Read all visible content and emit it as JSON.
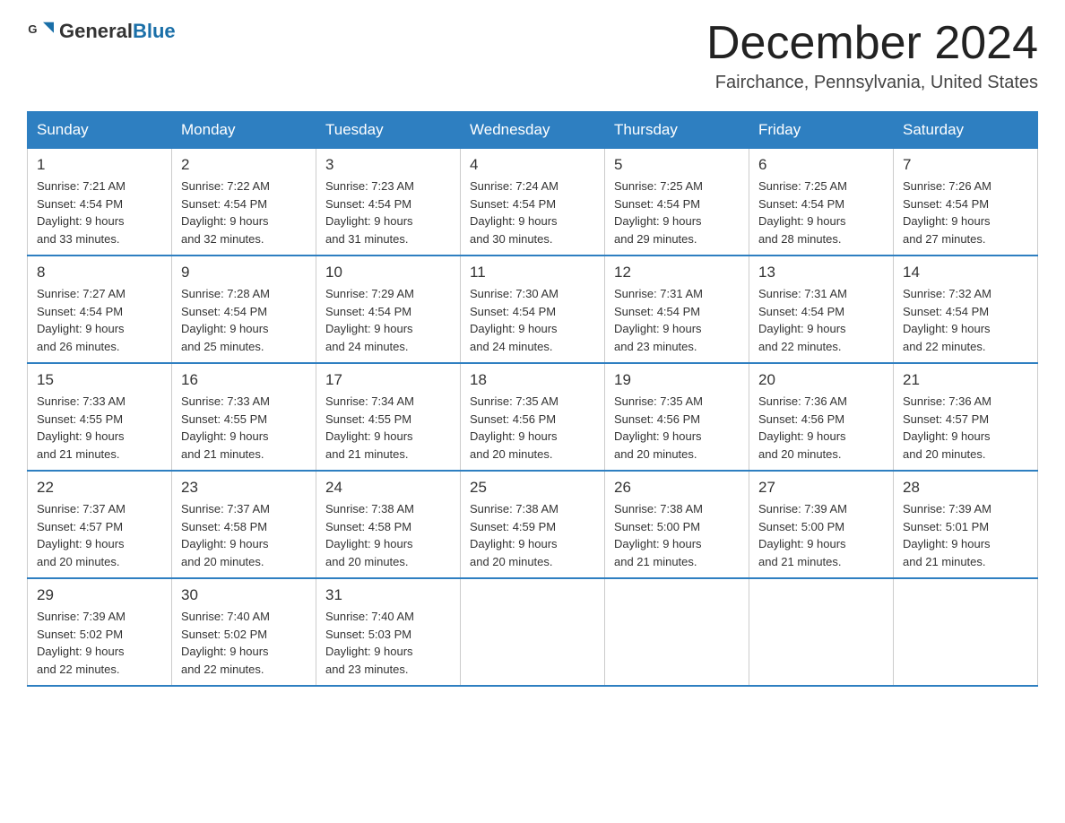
{
  "header": {
    "logo_general": "General",
    "logo_blue": "Blue",
    "title": "December 2024",
    "subtitle": "Fairchance, Pennsylvania, United States"
  },
  "weekdays": [
    "Sunday",
    "Monday",
    "Tuesday",
    "Wednesday",
    "Thursday",
    "Friday",
    "Saturday"
  ],
  "weeks": [
    [
      {
        "day": "1",
        "sunrise": "7:21 AM",
        "sunset": "4:54 PM",
        "daylight": "9 hours and 33 minutes."
      },
      {
        "day": "2",
        "sunrise": "7:22 AM",
        "sunset": "4:54 PM",
        "daylight": "9 hours and 32 minutes."
      },
      {
        "day": "3",
        "sunrise": "7:23 AM",
        "sunset": "4:54 PM",
        "daylight": "9 hours and 31 minutes."
      },
      {
        "day": "4",
        "sunrise": "7:24 AM",
        "sunset": "4:54 PM",
        "daylight": "9 hours and 30 minutes."
      },
      {
        "day": "5",
        "sunrise": "7:25 AM",
        "sunset": "4:54 PM",
        "daylight": "9 hours and 29 minutes."
      },
      {
        "day": "6",
        "sunrise": "7:25 AM",
        "sunset": "4:54 PM",
        "daylight": "9 hours and 28 minutes."
      },
      {
        "day": "7",
        "sunrise": "7:26 AM",
        "sunset": "4:54 PM",
        "daylight": "9 hours and 27 minutes."
      }
    ],
    [
      {
        "day": "8",
        "sunrise": "7:27 AM",
        "sunset": "4:54 PM",
        "daylight": "9 hours and 26 minutes."
      },
      {
        "day": "9",
        "sunrise": "7:28 AM",
        "sunset": "4:54 PM",
        "daylight": "9 hours and 25 minutes."
      },
      {
        "day": "10",
        "sunrise": "7:29 AM",
        "sunset": "4:54 PM",
        "daylight": "9 hours and 24 minutes."
      },
      {
        "day": "11",
        "sunrise": "7:30 AM",
        "sunset": "4:54 PM",
        "daylight": "9 hours and 24 minutes."
      },
      {
        "day": "12",
        "sunrise": "7:31 AM",
        "sunset": "4:54 PM",
        "daylight": "9 hours and 23 minutes."
      },
      {
        "day": "13",
        "sunrise": "7:31 AM",
        "sunset": "4:54 PM",
        "daylight": "9 hours and 22 minutes."
      },
      {
        "day": "14",
        "sunrise": "7:32 AM",
        "sunset": "4:54 PM",
        "daylight": "9 hours and 22 minutes."
      }
    ],
    [
      {
        "day": "15",
        "sunrise": "7:33 AM",
        "sunset": "4:55 PM",
        "daylight": "9 hours and 21 minutes."
      },
      {
        "day": "16",
        "sunrise": "7:33 AM",
        "sunset": "4:55 PM",
        "daylight": "9 hours and 21 minutes."
      },
      {
        "day": "17",
        "sunrise": "7:34 AM",
        "sunset": "4:55 PM",
        "daylight": "9 hours and 21 minutes."
      },
      {
        "day": "18",
        "sunrise": "7:35 AM",
        "sunset": "4:56 PM",
        "daylight": "9 hours and 20 minutes."
      },
      {
        "day": "19",
        "sunrise": "7:35 AM",
        "sunset": "4:56 PM",
        "daylight": "9 hours and 20 minutes."
      },
      {
        "day": "20",
        "sunrise": "7:36 AM",
        "sunset": "4:56 PM",
        "daylight": "9 hours and 20 minutes."
      },
      {
        "day": "21",
        "sunrise": "7:36 AM",
        "sunset": "4:57 PM",
        "daylight": "9 hours and 20 minutes."
      }
    ],
    [
      {
        "day": "22",
        "sunrise": "7:37 AM",
        "sunset": "4:57 PM",
        "daylight": "9 hours and 20 minutes."
      },
      {
        "day": "23",
        "sunrise": "7:37 AM",
        "sunset": "4:58 PM",
        "daylight": "9 hours and 20 minutes."
      },
      {
        "day": "24",
        "sunrise": "7:38 AM",
        "sunset": "4:58 PM",
        "daylight": "9 hours and 20 minutes."
      },
      {
        "day": "25",
        "sunrise": "7:38 AM",
        "sunset": "4:59 PM",
        "daylight": "9 hours and 20 minutes."
      },
      {
        "day": "26",
        "sunrise": "7:38 AM",
        "sunset": "5:00 PM",
        "daylight": "9 hours and 21 minutes."
      },
      {
        "day": "27",
        "sunrise": "7:39 AM",
        "sunset": "5:00 PM",
        "daylight": "9 hours and 21 minutes."
      },
      {
        "day": "28",
        "sunrise": "7:39 AM",
        "sunset": "5:01 PM",
        "daylight": "9 hours and 21 minutes."
      }
    ],
    [
      {
        "day": "29",
        "sunrise": "7:39 AM",
        "sunset": "5:02 PM",
        "daylight": "9 hours and 22 minutes."
      },
      {
        "day": "30",
        "sunrise": "7:40 AM",
        "sunset": "5:02 PM",
        "daylight": "9 hours and 22 minutes."
      },
      {
        "day": "31",
        "sunrise": "7:40 AM",
        "sunset": "5:03 PM",
        "daylight": "9 hours and 23 minutes."
      },
      null,
      null,
      null,
      null
    ]
  ],
  "labels": {
    "sunrise": "Sunrise:",
    "sunset": "Sunset:",
    "daylight": "Daylight:"
  }
}
